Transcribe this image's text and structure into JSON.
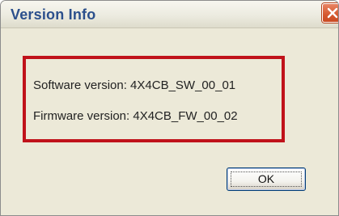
{
  "window": {
    "title": "Version Info"
  },
  "versions": {
    "software": "Software version: 4X4CB_SW_00_01",
    "firmware": "Firmware version: 4X4CB_FW_00_02"
  },
  "buttons": {
    "ok_label": "OK",
    "close_icon": "close-icon"
  },
  "colors": {
    "title_text": "#2b4f8c",
    "highlight_border": "#c0121a",
    "dialog_background": "#ece9d8",
    "close_button": "#d5582f"
  }
}
